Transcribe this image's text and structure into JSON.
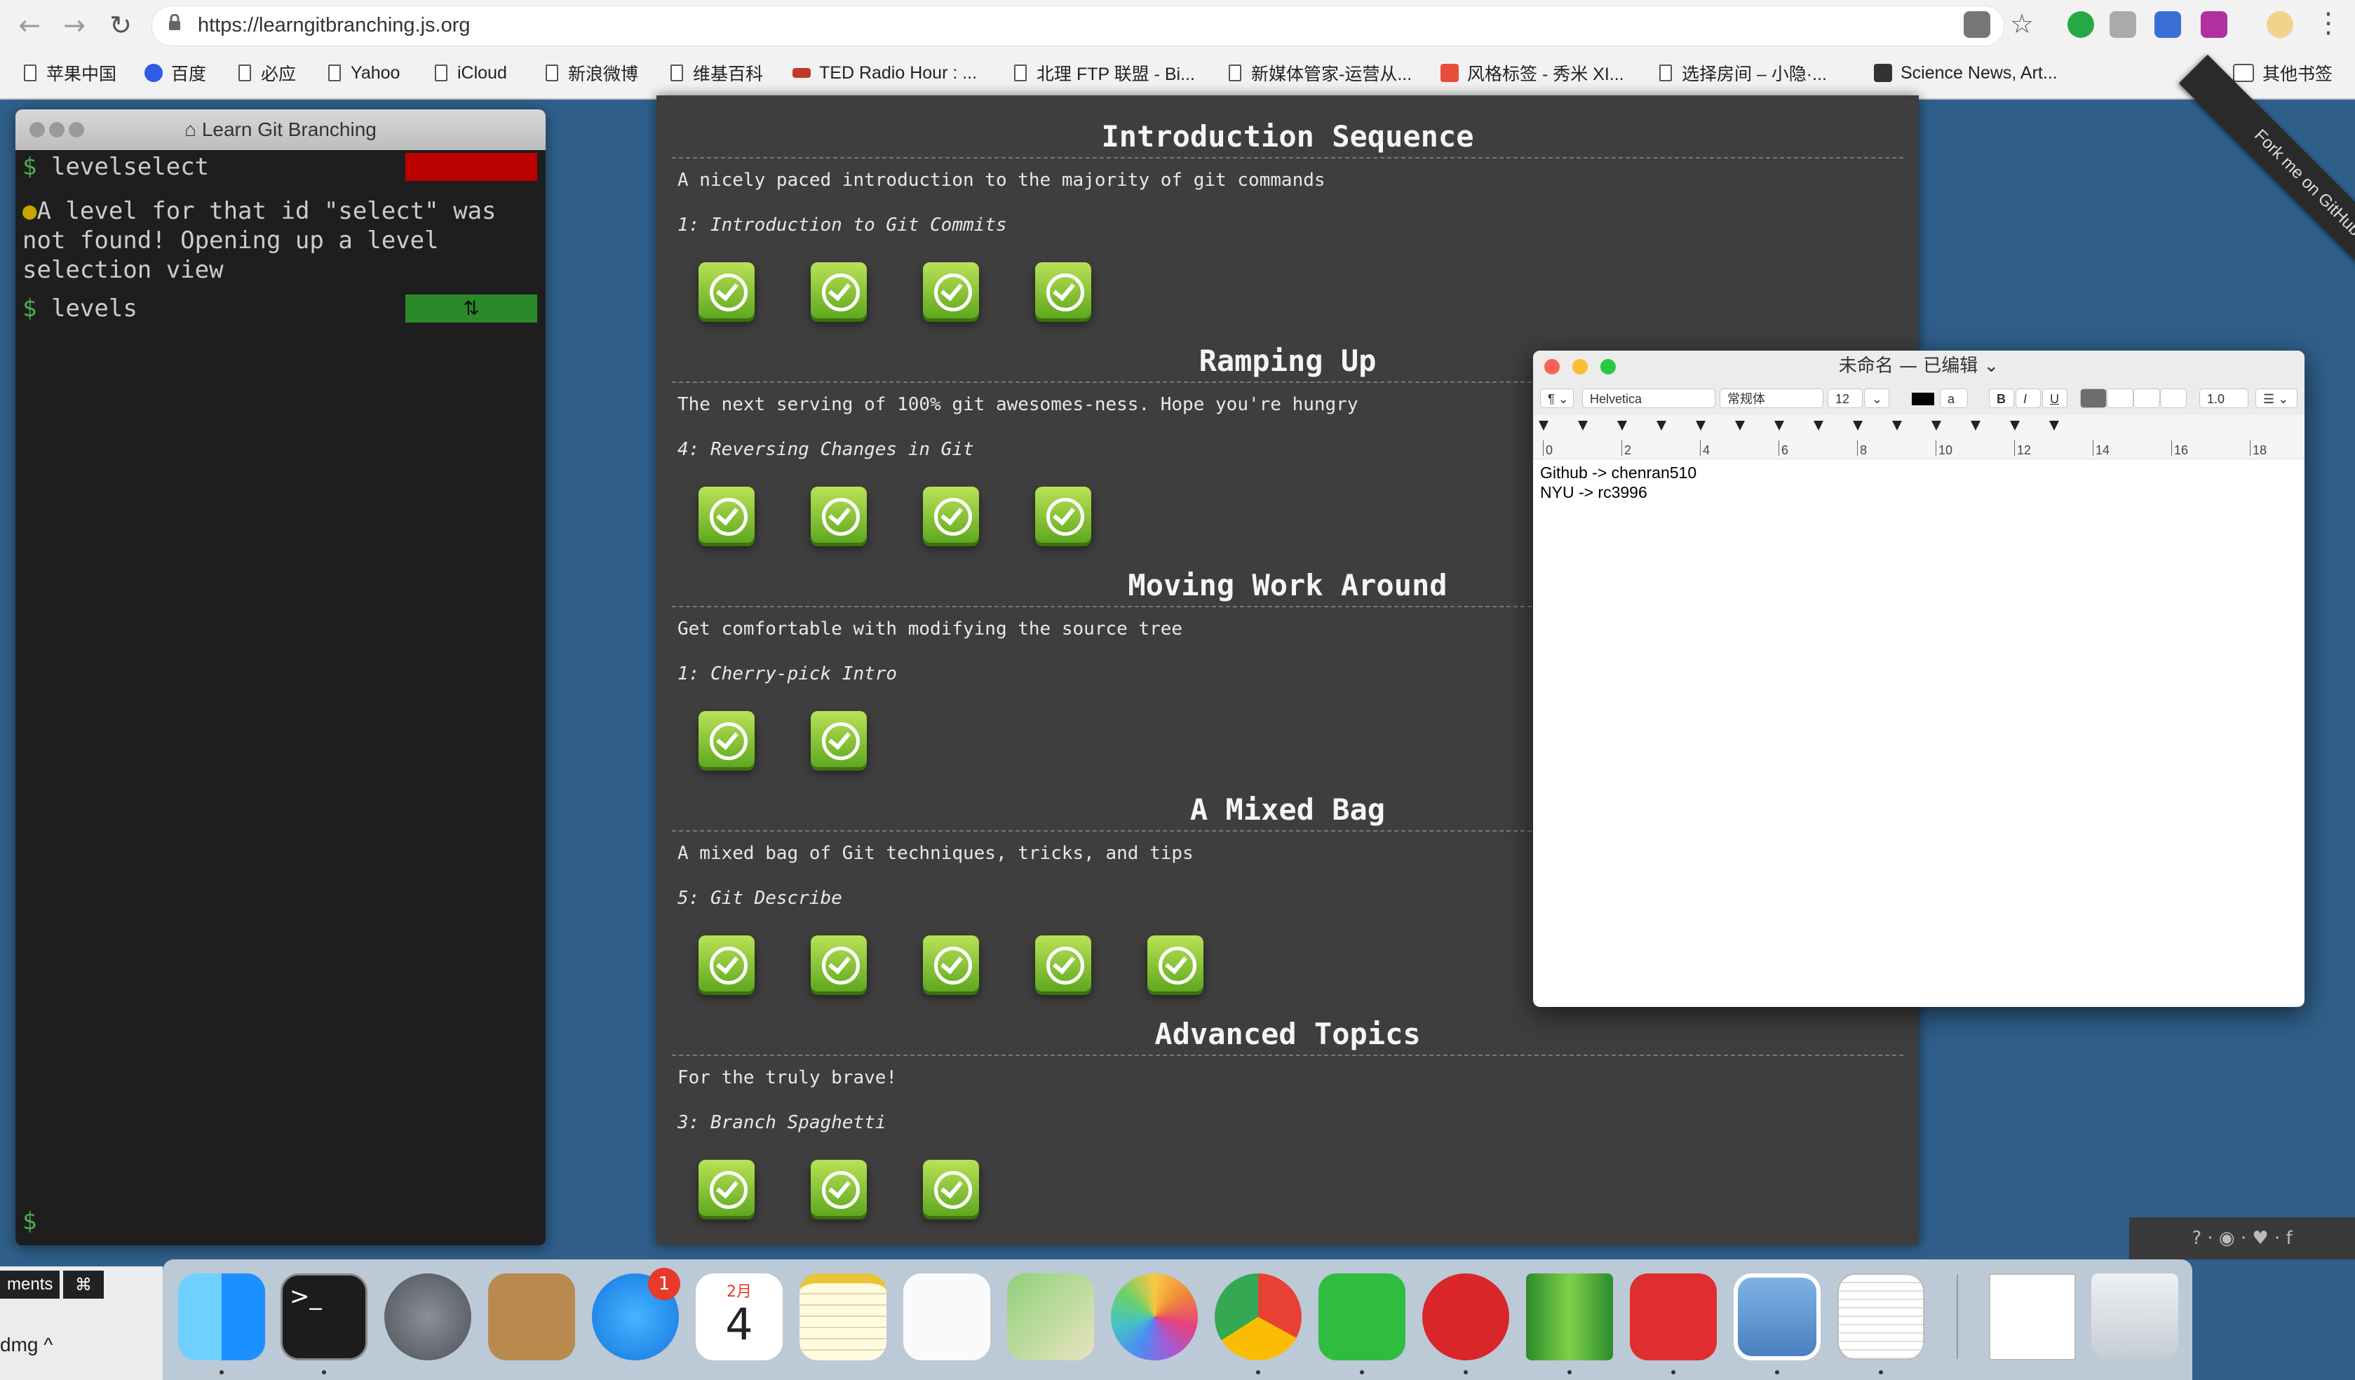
{
  "browser": {
    "url": "https://learngitbranching.js.org",
    "bookmarks": [
      "苹果中国",
      "百度",
      "必应",
      "Yahoo",
      "iCloud",
      "新浪微博",
      "维基百科",
      "TED Radio Hour : ...",
      "北理 FTP 联盟 - Bi...",
      "新媒体管家-运营从...",
      "风格标签 - 秀米 XI...",
      "选择房间 – 小隐·...",
      "Science News, Art...",
      "其他书签"
    ],
    "more": "»"
  },
  "terminal": {
    "title": "Learn Git Branching",
    "home_icon": "home-icon",
    "line1": "levelselect",
    "msg": "A level for that id \"select\" was not found! Opening up a level selection view",
    "line2": "levels",
    "prompt": "$"
  },
  "sections": [
    {
      "title": "Introduction Sequence",
      "desc": "A nicely paced introduction to the majority of git commands",
      "sub": "1: Introduction to Git Commits",
      "count": 4
    },
    {
      "title": "Ramping Up",
      "desc": "The next serving of 100% git awesomes-ness. Hope you're hungry",
      "sub": "4: Reversing Changes in Git",
      "count": 4
    },
    {
      "title": "Moving Work Around",
      "desc": "Get comfortable with modifying the source tree",
      "sub": "1: Cherry-pick Intro",
      "count": 2
    },
    {
      "title": "A Mixed Bag",
      "desc": "A mixed bag of Git techniques, tricks, and tips",
      "sub": "5: Git Describe",
      "count": 5
    },
    {
      "title": "Advanced Topics",
      "desc": "For the truly brave!",
      "sub": "3: Branch Spaghetti",
      "count": 3
    }
  ],
  "ribbon": "Fork me on GitHub",
  "textedit": {
    "title": "未命名 — 已编辑 ⌄",
    "font": "Helvetica",
    "style": "常规体",
    "size": "12",
    "spacing": "1.0",
    "ruler": [
      "0",
      "2",
      "4",
      "6",
      "8",
      "10",
      "12",
      "14",
      "16",
      "18"
    ],
    "lines": [
      "Github -> chenran510",
      "NYU -> rc3996"
    ]
  },
  "social": "? · ◉ · ♥ · f",
  "dock": {
    "left_chip": "ments",
    "cmd": "⌘",
    "dmg": "dmg  ^",
    "badge": "1",
    "calendar_month": "2月",
    "calendar_day": "4"
  },
  "colors": {
    "accent_green": "#5fa81f",
    "desktop": "#2f5f8a",
    "panel": "#3e3e3e"
  }
}
